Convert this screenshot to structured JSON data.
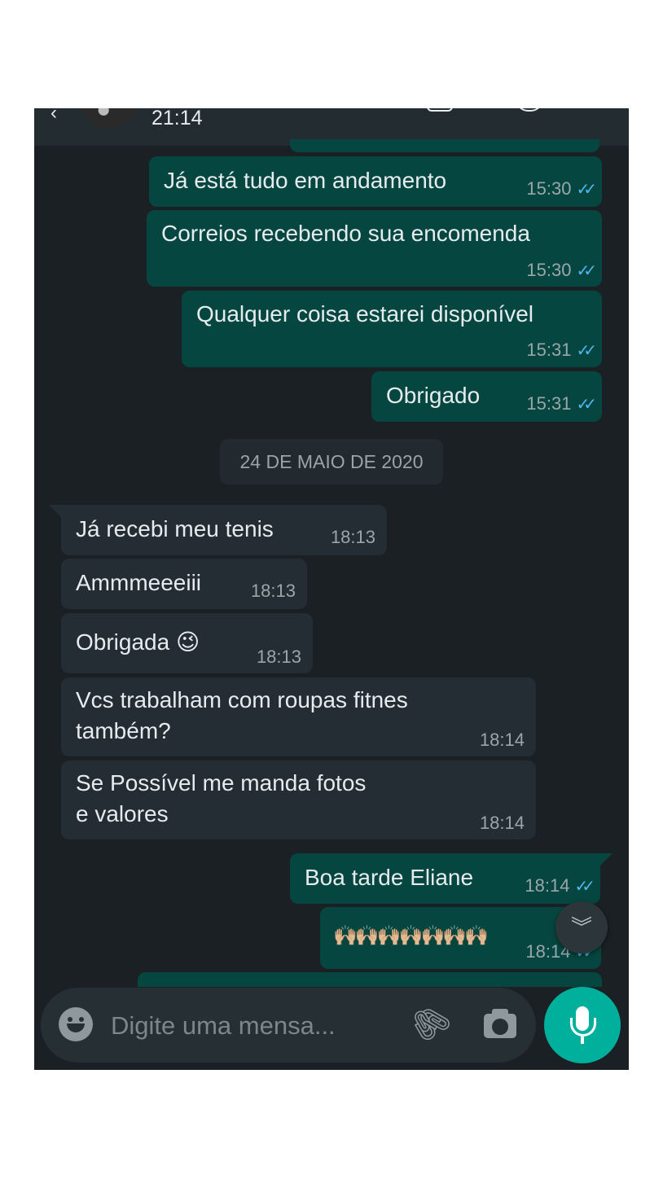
{
  "header": {
    "time": "21:14"
  },
  "date_separator": "24 DE MAIO DE 2020",
  "messages": [
    {
      "dir": "out",
      "text": "Já está tudo em andamento",
      "time": "15:30",
      "status": "read"
    },
    {
      "dir": "out",
      "text": "Correios recebendo sua encomenda",
      "time": "15:30",
      "status": "read"
    },
    {
      "dir": "out",
      "text": "Qualquer coisa estarei disponível",
      "time": "15:31",
      "status": "read"
    },
    {
      "dir": "out",
      "text": "Obrigado",
      "time": "15:31",
      "status": "read"
    },
    {
      "dir": "in",
      "text": "Já recebi meu tenis",
      "time": "18:13"
    },
    {
      "dir": "in",
      "text": "Ammmeeeiii",
      "time": "18:13"
    },
    {
      "dir": "in",
      "text": "Obrigada 😉",
      "time": "18:13"
    },
    {
      "dir": "in",
      "text": "Vcs trabalham com roupas fitnes\ntambém?",
      "time": "18:14"
    },
    {
      "dir": "in",
      "text": "Se Possível  me manda fotos\ne valores",
      "time": "18:14"
    },
    {
      "dir": "out",
      "text": "Boa tarde Eliane",
      "time": "18:14",
      "status": "read"
    },
    {
      "dir": "out",
      "text": "🙌🏼🙌🏼🙌🏼🙌🏼🙌🏼🙌🏼🙌🏼",
      "time": "18:14",
      "status": "read"
    }
  ],
  "composer": {
    "placeholder": "Digite uma mensa..."
  },
  "icons": {
    "read_receipt": "double-check-icon",
    "emoji": "emoji-icon",
    "attach": "paperclip-icon",
    "camera": "camera-icon",
    "mic": "mic-icon",
    "scroll_down": "chevron-double-down-icon"
  },
  "colors": {
    "background": "#1b2024",
    "outgoing_bubble": "#054740",
    "incoming_bubble": "#232d33",
    "read_tick": "#4fb6ec",
    "mic_button": "#00af9c"
  }
}
